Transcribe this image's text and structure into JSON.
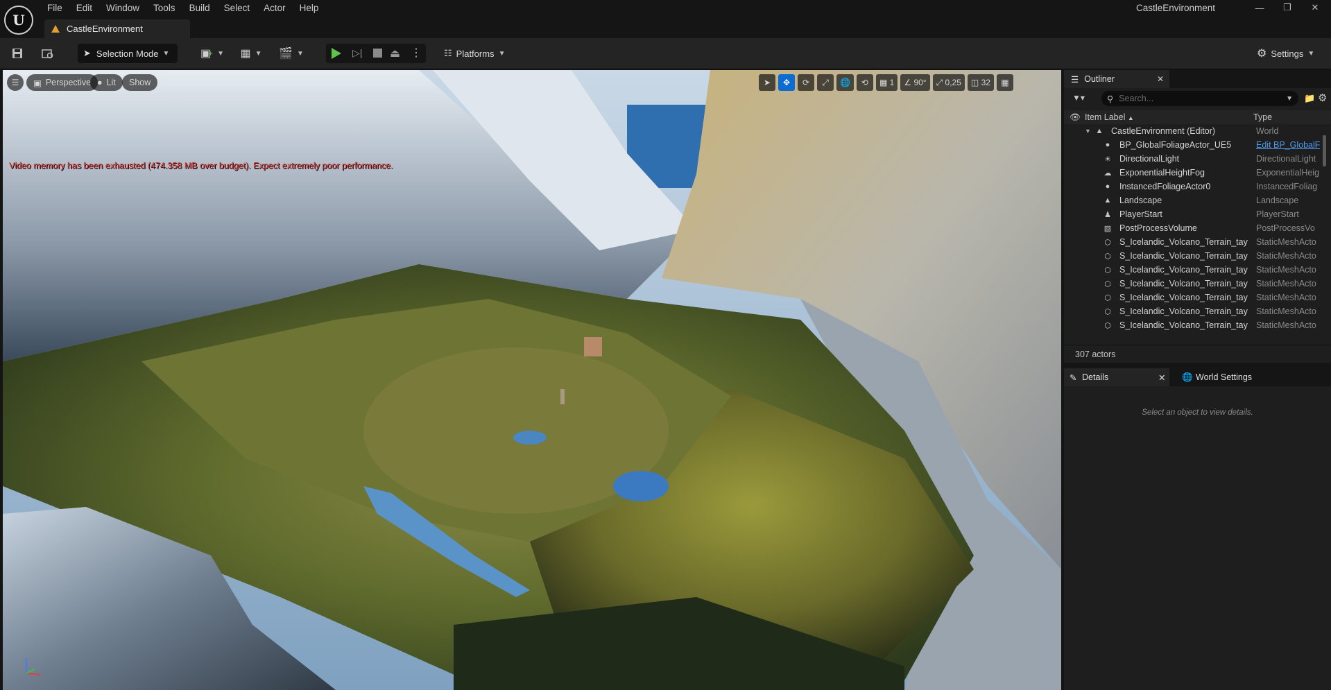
{
  "app": {
    "window_title": "CastleEnvironment",
    "logo": "U",
    "document_tab": "CastleEnvironment"
  },
  "menu": [
    "File",
    "Edit",
    "Window",
    "Tools",
    "Build",
    "Select",
    "Actor",
    "Help"
  ],
  "toolbar": {
    "selection_mode": "Selection Mode",
    "platforms": "Platforms",
    "settings": "Settings"
  },
  "viewport": {
    "perspective": "Perspective",
    "lit": "Lit",
    "show": "Show",
    "grid_size": "1",
    "rotation_snap": "90°",
    "scale_snap": "0,25",
    "camera_speed": "32",
    "warning": "Video memory has been exhausted (474.358 MB over budget). Expect extremely poor performance."
  },
  "outliner": {
    "tab_label": "Outliner",
    "search_placeholder": "Search...",
    "col_label": "Item Label",
    "col_type": "Type",
    "rows": [
      {
        "label": "CastleEnvironment (Editor)",
        "type": "World",
        "icon": "world-icon"
      },
      {
        "label": "BP_GlobalFoliageActor_UE5",
        "type": "Edit BP_GlobalF",
        "icon": "blueprint-icon"
      },
      {
        "label": "DirectionalLight",
        "type": "DirectionalLight",
        "icon": "sun-icon"
      },
      {
        "label": "ExponentialHeightFog",
        "type": "ExponentialHeig",
        "icon": "fog-icon"
      },
      {
        "label": "InstancedFoliageActor0",
        "type": "InstancedFoliag",
        "icon": "actor-icon"
      },
      {
        "label": "Landscape",
        "type": "Landscape",
        "icon": "landscape-icon"
      },
      {
        "label": "PlayerStart",
        "type": "PlayerStart",
        "icon": "player-start-icon"
      },
      {
        "label": "PostProcessVolume",
        "type": "PostProcessVo",
        "icon": "volume-icon"
      },
      {
        "label": "S_Icelandic_Volcano_Terrain_tay",
        "type": "StaticMeshActo",
        "icon": "static-mesh-icon"
      },
      {
        "label": "S_Icelandic_Volcano_Terrain_tay",
        "type": "StaticMeshActo",
        "icon": "static-mesh-icon"
      },
      {
        "label": "S_Icelandic_Volcano_Terrain_tay",
        "type": "StaticMeshActo",
        "icon": "static-mesh-icon"
      },
      {
        "label": "S_Icelandic_Volcano_Terrain_tay",
        "type": "StaticMeshActo",
        "icon": "static-mesh-icon"
      },
      {
        "label": "S_Icelandic_Volcano_Terrain_tay",
        "type": "StaticMeshActo",
        "icon": "static-mesh-icon"
      },
      {
        "label": "S_Icelandic_Volcano_Terrain_tay",
        "type": "StaticMeshActo",
        "icon": "static-mesh-icon"
      },
      {
        "label": "S_Icelandic_Volcano_Terrain_tay",
        "type": "StaticMeshActo",
        "icon": "static-mesh-icon"
      }
    ],
    "actor_count": "307 actors"
  },
  "details": {
    "tab_details": "Details",
    "tab_world_settings": "World Settings",
    "empty_message": "Select an object to view details."
  },
  "colors": {
    "accent_blue": "#0e6bd0",
    "play_green": "#5fc24a",
    "warning_red": "#e23a3a",
    "link_blue": "#4e9cf0"
  }
}
